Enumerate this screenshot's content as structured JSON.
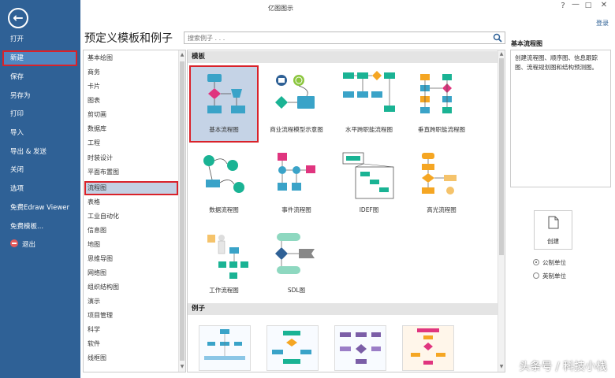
{
  "app": {
    "title": "亿图图示",
    "login": "登录"
  },
  "sidebar": {
    "items": [
      {
        "label": "打开"
      },
      {
        "label": "新建"
      },
      {
        "label": "保存"
      },
      {
        "label": "另存为"
      },
      {
        "label": "打印"
      },
      {
        "label": "导入"
      },
      {
        "label": "导出 & 发送"
      },
      {
        "label": "关闭"
      },
      {
        "label": "选项"
      },
      {
        "label": "免费Edraw Viewer"
      },
      {
        "label": "免费模板..."
      },
      {
        "label": "退出"
      }
    ],
    "active": "新建"
  },
  "main": {
    "title": "预定义模板和例子",
    "search_placeholder": "搜索例子 . . ."
  },
  "categories": {
    "items": [
      "基本绘图",
      "商务",
      "卡片",
      "图表",
      "剪切画",
      "数据库",
      "工程",
      "时装设计",
      "平面布置图",
      "流程图",
      "表格",
      "工业自动化",
      "信息图",
      "地图",
      "思维导图",
      "网络图",
      "组织结构图",
      "演示",
      "项目管理",
      "科学",
      "软件",
      "线框图"
    ],
    "active": "流程图"
  },
  "templates": {
    "section_label": "模板",
    "items": [
      {
        "label": "基本流程图"
      },
      {
        "label": "商业流程模型示意图"
      },
      {
        "label": "水平跨职能流程图"
      },
      {
        "label": "垂直跨职能流程图"
      },
      {
        "label": "数据流程图"
      },
      {
        "label": "事件流程图"
      },
      {
        "label": "IDEF图"
      },
      {
        "label": "高光流程图"
      },
      {
        "label": "工作流程图"
      },
      {
        "label": "SDL图"
      }
    ],
    "selected": "基本流程图"
  },
  "examples": {
    "section_label": "例子"
  },
  "details": {
    "title": "基本流程图",
    "description": "创建流程图、顺序图、信息跟踪图、流程规划图和结构预测图。",
    "create_label": "创建",
    "units": [
      {
        "label": "公制单位",
        "checked": true
      },
      {
        "label": "英制单位",
        "checked": false
      }
    ]
  },
  "watermark": "头条号 / 科技小栈",
  "colors": {
    "sidebar": "#2f6196",
    "highlight": "#d9222a",
    "selection": "#c5d3e6",
    "shape_teal": "#1ab394",
    "shape_blue": "#3aa3c8",
    "shape_orange": "#f5a623"
  }
}
